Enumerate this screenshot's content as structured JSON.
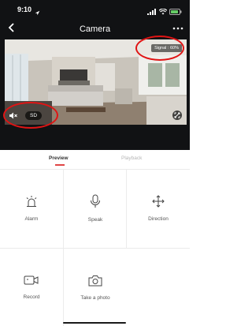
{
  "status_bar": {
    "time": "9:10",
    "icons": [
      "location-arrow-icon",
      "signal-bars-icon",
      "wifi-icon",
      "battery-icon"
    ]
  },
  "header": {
    "title": "Camera",
    "back_icon": "chevron-left-icon",
    "more_icon": "more-dots-icon"
  },
  "video": {
    "signal_label": "Signal : 60%",
    "sd_label": "SD",
    "mute_icon": "speaker-mute-icon",
    "fullscreen_icon": "fullscreen-icon",
    "annotation_color": "#e01414"
  },
  "tabs": {
    "preview": "Preview",
    "playback": "Playback",
    "accent": "#e04646"
  },
  "actions": [
    {
      "label": "Alarm",
      "icon": "alarm-light-icon"
    },
    {
      "label": "Speak",
      "icon": "microphone-icon"
    },
    {
      "label": "Direction",
      "icon": "direction-arrows-icon"
    },
    {
      "label": "Record",
      "icon": "video-record-icon"
    },
    {
      "label": "Take a photo",
      "icon": "camera-icon"
    }
  ]
}
